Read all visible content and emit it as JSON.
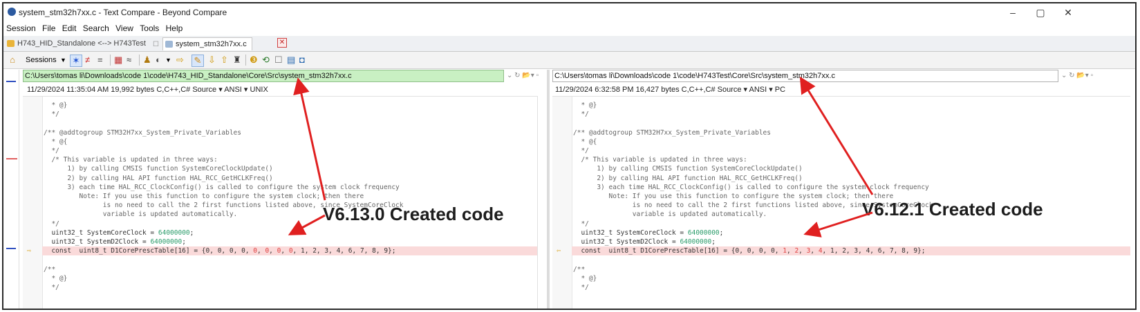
{
  "window": {
    "title": "system_stm32h7xx.c - Text Compare - Beyond Compare",
    "controls": {
      "minimize": "–",
      "maximize": "▢",
      "close": "✕"
    }
  },
  "menu": [
    "Session",
    "File",
    "Edit",
    "Search",
    "View",
    "Tools",
    "Help"
  ],
  "tabs": [
    {
      "label": "H743_HID_Standalone <--> H743Test",
      "close": "☐",
      "active": false
    },
    {
      "label": "system_stm32h7xx.c",
      "close": "",
      "active": true
    }
  ],
  "tab_close_glyph": "✕",
  "toolbar": {
    "sessions_label": "Sessions",
    "icons": [
      "home-icon",
      "sessions-dropdown",
      "all-diff-icon",
      "not-equal-icon",
      "equal-icon",
      "columns-icon",
      "approx-icon",
      "rules-icon",
      "format-icon",
      "swap-icon",
      "edit-icon",
      "next-diff-icon",
      "prev-diff-icon",
      "find-icon",
      "merge-icon",
      "refresh-icon",
      "expand-icon",
      "options-icon",
      "save-icon"
    ]
  },
  "left": {
    "path": "C:\\Users\\tomas li\\Downloads\\code 1\\code\\H743_HID_Standalone\\Core\\Src\\system_stm32h7xx.c",
    "info": "11/29/2024 11:35:04 AM   19,992 bytes   C,C++,C# Source ▾  ANSI ▾  UNIX",
    "lines": [
      "  * @}",
      "  */",
      "",
      "/** @addtogroup STM32H7xx_System_Private_Variables",
      "  * @{",
      "  */",
      "  /* This variable is updated in three ways:",
      "      1) by calling CMSIS function SystemCoreClockUpdate()",
      "      2) by calling HAL API function HAL_RCC_GetHCLKFreq()",
      "      3) each time HAL_RCC_ClockConfig() is called to configure the system clock frequency",
      "         Note: If you use this function to configure the system clock; then there",
      "               is no need to call the 2 first functions listed above, since SystemCoreClock",
      "               variable is updated automatically.",
      "  */",
      "  uint32_t SystemCoreClock = 64000000;",
      "  uint32_t SystemD2Clock = 64000000;",
      "  const  uint8_t D1CorePrescTable[16] = {0, 0, 0, 0, 0, 0, 0, 0, 1, 2, 3, 4, 6, 7, 8, 9};",
      "",
      "/**",
      "  * @}",
      "  */"
    ]
  },
  "right": {
    "path": "C:\\Users\\tomas li\\Downloads\\code 1\\code\\H743Test\\Core\\Src\\system_stm32h7xx.c",
    "info": "11/29/2024 6:32:58 PM   16,427 bytes   C,C++,C# Source ▾  ANSI ▾  PC",
    "lines": [
      "  * @}",
      "  */",
      "",
      "/** @addtogroup STM32H7xx_System_Private_Variables",
      "  * @{",
      "  */",
      "  /* This variable is updated in three ways:",
      "      1) by calling CMSIS function SystemCoreClockUpdate()",
      "      2) by calling HAL API function HAL_RCC_GetHCLKFreq()",
      "      3) each time HAL_RCC_ClockConfig() is called to configure the system clock frequency",
      "         Note: If you use this function to configure the system clock; then there",
      "               is no need to call the 2 first functions listed above, since SystemCoreClock",
      "               variable is updated automatically.",
      "  */",
      "  uint32_t SystemCoreClock = 64000000;",
      "  uint32_t SystemD2Clock = 64000000;",
      "  const  uint8_t D1CorePrescTable[16] = {0, 0, 0, 0, 1, 2, 3, 4, 1, 2, 3, 4, 6, 7, 8, 9};",
      "",
      "/**",
      "  * @}",
      "  */"
    ]
  },
  "annotations": {
    "left_label": "V6.13.0 Created code",
    "right_label": "V6.12.1 Created code",
    "arrow_color": "#e02020"
  },
  "colors": {
    "path_bg": "#c9f0c3",
    "diff_bg": "#fadada",
    "diff_text": "#e04040",
    "number_text": "#2a9c6a"
  }
}
